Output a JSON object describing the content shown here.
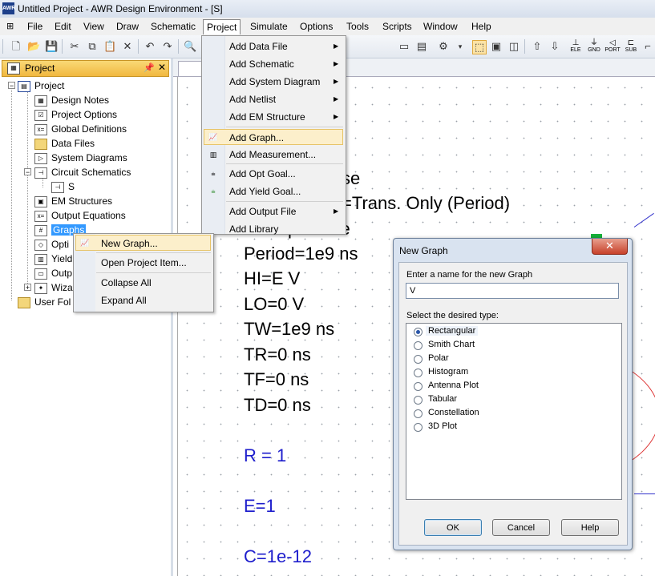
{
  "window": {
    "title": "Untitled Project - AWR Design Environment - [S]",
    "app_icon_text": "AWR"
  },
  "menubar": [
    "File",
    "Edit",
    "View",
    "Draw",
    "Schematic",
    "Project",
    "Simulate",
    "Options",
    "Tools",
    "Scripts",
    "Window",
    "Help"
  ],
  "toolbar": {
    "small_labels": [
      "ELE",
      "GND",
      "PORT",
      "SUB"
    ]
  },
  "project_panel": {
    "title": "Project",
    "pin_icon": "pin-icon",
    "close_glyph": "✕",
    "tree": [
      {
        "label": "Project",
        "level": 0
      },
      {
        "label": "Design Notes",
        "level": 1
      },
      {
        "label": "Project Options",
        "level": 1
      },
      {
        "label": "Global Definitions",
        "level": 1
      },
      {
        "label": "Data Files",
        "level": 1
      },
      {
        "label": "System Diagrams",
        "level": 1
      },
      {
        "label": "Circuit Schematics",
        "level": 1
      },
      {
        "label": "S",
        "level": 2
      },
      {
        "label": "EM Structures",
        "level": 1
      },
      {
        "label": "Output Equations",
        "level": 1
      },
      {
        "label": "Graphs",
        "level": 1
      },
      {
        "label": "Opti",
        "level": 1
      },
      {
        "label": "Yield",
        "level": 1
      },
      {
        "label": "Outp",
        "level": 1
      },
      {
        "label": "Wiza",
        "level": 1
      },
      {
        "label": "User Fol",
        "level": 0
      }
    ]
  },
  "project_menu": {
    "items": [
      {
        "label": "Add Data File",
        "submenu": true
      },
      {
        "label": "Add Schematic",
        "submenu": true
      },
      {
        "label": "Add System Diagram",
        "submenu": true
      },
      {
        "label": "Add Netlist",
        "submenu": true
      },
      {
        "label": "Add EM Structure",
        "submenu": true
      },
      {
        "label": "Add Graph...",
        "submenu": false,
        "highlighted": true
      },
      {
        "label": "Add Measurement...",
        "submenu": false
      },
      {
        "label": "Add Opt Goal...",
        "submenu": false
      },
      {
        "label": "Add Yield Goal...",
        "submenu": false
      },
      {
        "label": "Add Output File",
        "submenu": true
      },
      {
        "label": "Add Library",
        "submenu": false
      }
    ]
  },
  "context_menu": {
    "items": [
      "New Graph...",
      "Open Project Item...",
      "Collapse All",
      "Expand All"
    ]
  },
  "schematic_text": {
    "black_lines": [
      "se",
      "=Trans. Only (Period)",
      "Sweep=None",
      "Period=1e9 ns",
      "HI=E V",
      "LO=0 V",
      "TW=1e9 ns",
      "TR=0 ns",
      "TF=0 ns",
      "TD=0 ns"
    ],
    "blue_lines": [
      "R = 1",
      "E=1",
      "C=1e-12"
    ]
  },
  "dialog": {
    "title": "New Graph",
    "close_glyph": "✕",
    "name_label": "Enter a name for the new Graph",
    "name_value": "V",
    "type_label": "Select the desired type:",
    "types": [
      "Rectangular",
      "Smith Chart",
      "Polar",
      "Histogram",
      "Antenna Plot",
      "Tabular",
      "Constellation",
      "3D Plot"
    ],
    "selected_type": "Rectangular",
    "buttons": {
      "ok": "OK",
      "cancel": "Cancel",
      "help": "Help"
    }
  },
  "colors": {
    "menu_highlight": "#fcefcb",
    "schematic_blue": "#1d1dcc",
    "panel_header": "#f1b840"
  }
}
